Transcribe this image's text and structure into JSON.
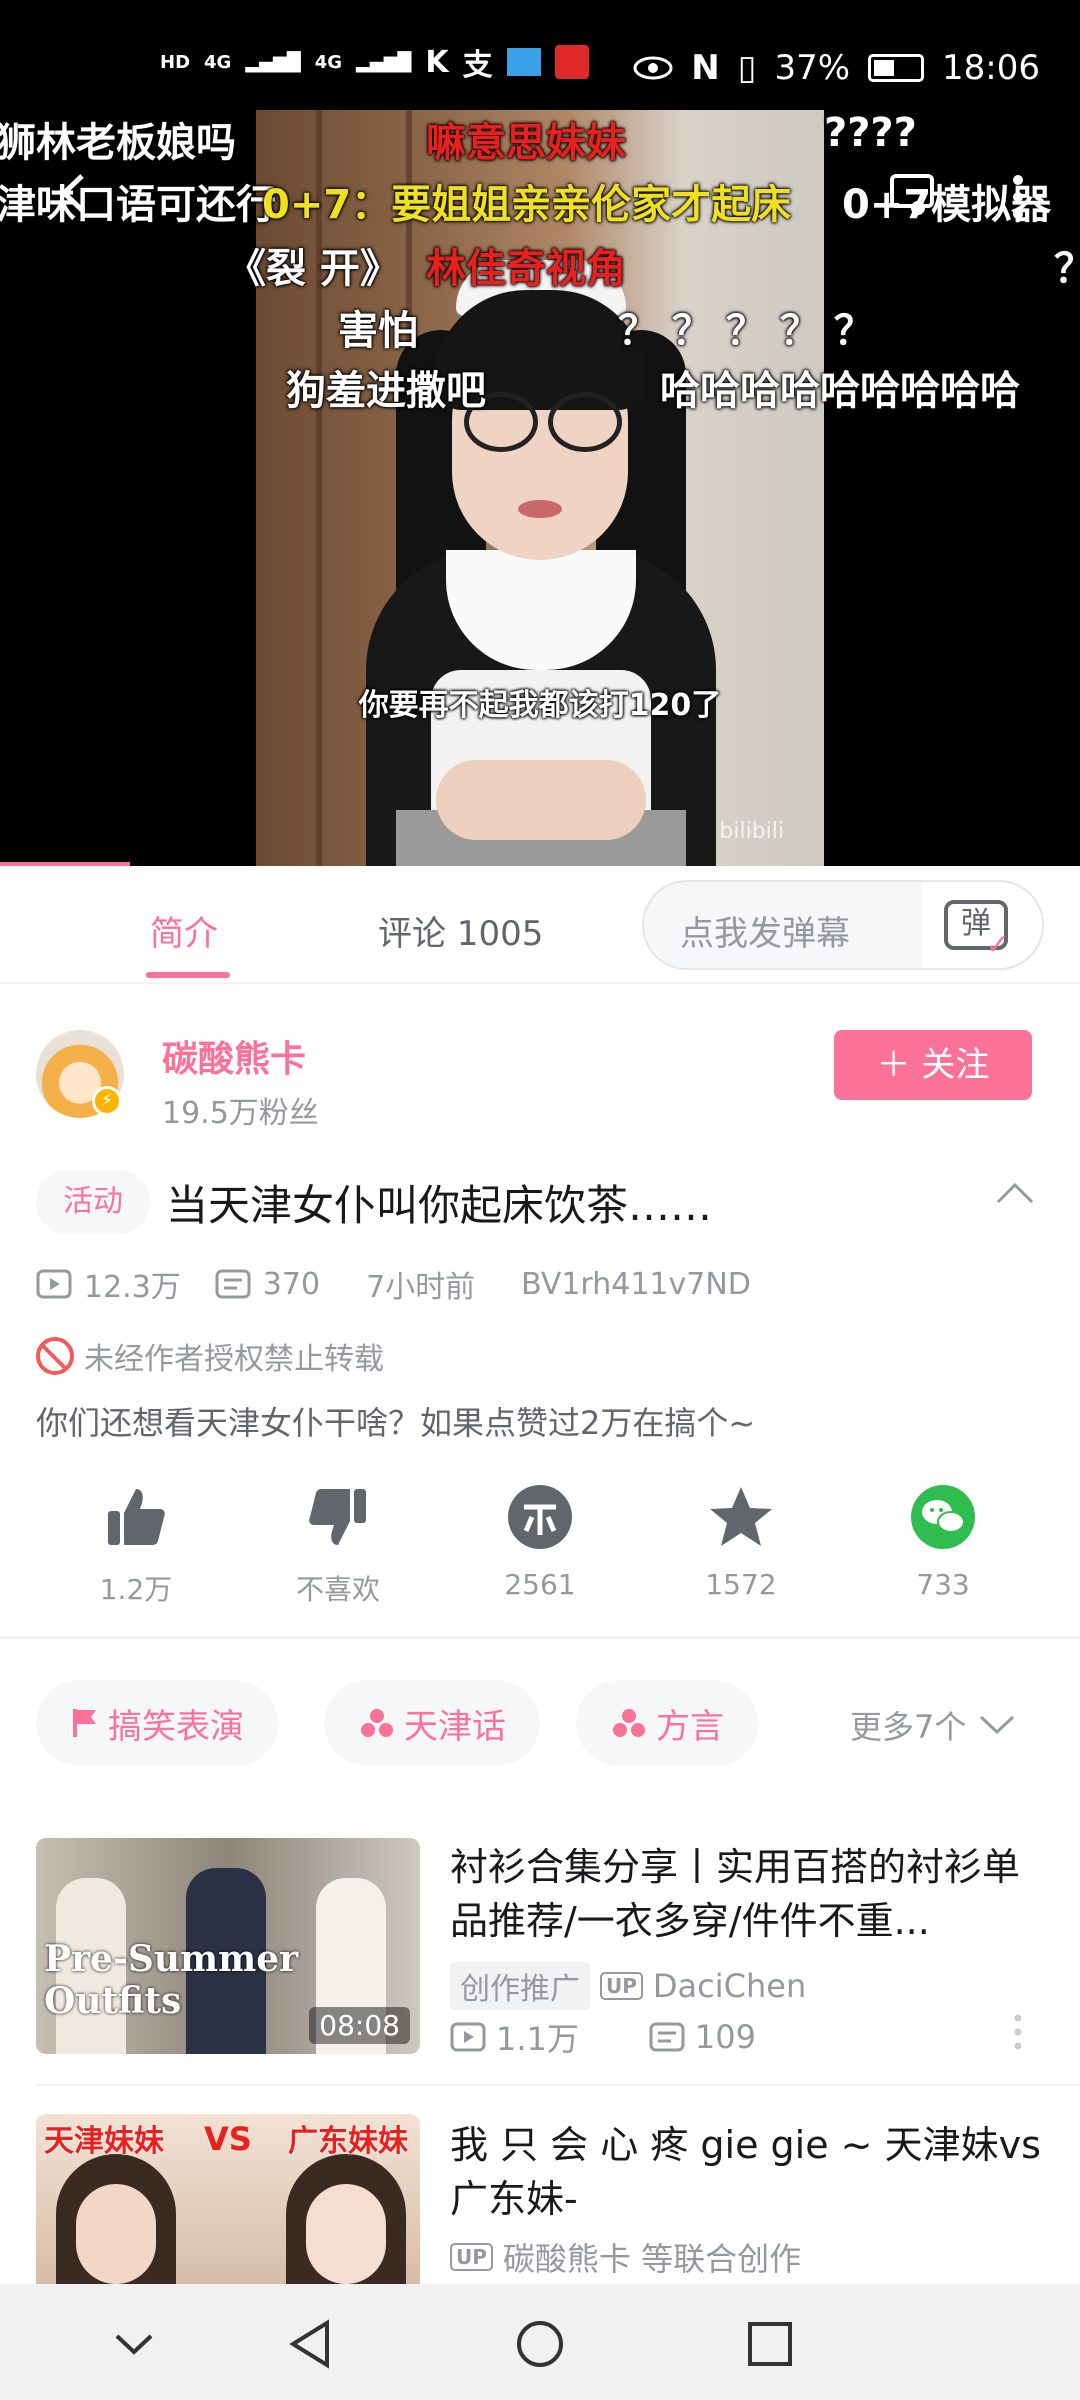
{
  "status_bar": {
    "network_labels": [
      "HD",
      "4G",
      "4G"
    ],
    "battery": "37%",
    "time": "18:06"
  },
  "video": {
    "subtitle": "你要再不起我都该打120了",
    "watermark": "bilibili",
    "danmaku": [
      {
        "text": "狮林老板娘吗",
        "color": "#ffffff"
      },
      {
        "text": "嘛意思妹妹",
        "color": "#e8211e"
      },
      {
        "text": "????",
        "color": "#ffffff"
      },
      {
        "text": "津味口语可还行",
        "color": "#ffffff"
      },
      {
        "text": "0+7：要姐姐亲亲伦家才起床",
        "color": "#f0e020"
      },
      {
        "text": "0+7模拟器",
        "color": "#ffffff"
      },
      {
        "text": "《裂 开》",
        "color": "#ffffff"
      },
      {
        "text": "林佳奇视角",
        "color": "#e8211e"
      },
      {
        "text": "？",
        "color": "#ffffff"
      },
      {
        "text": "害怕",
        "color": "#ffffff"
      },
      {
        "text": "？ ？ ？ ？ ？",
        "color": "#ffffff"
      },
      {
        "text": "狗羞进撒吧",
        "color": "#ffffff"
      },
      {
        "text": "哈哈哈哈哈哈哈哈哈",
        "color": "#ffffff"
      }
    ],
    "progress_fraction": 0.12
  },
  "tabs": {
    "intro": "简介",
    "comments": "评论 1005",
    "danmaku_placeholder": "点我发弹幕",
    "danmaku_toggle_glyph": "弹"
  },
  "uploader": {
    "name": "碳酸熊卡",
    "fans": "19.5万粉丝",
    "follow_label": "＋ 关注"
  },
  "video_info": {
    "activity_tag": "活动",
    "title": "当天津女仆叫你起床饮茶……",
    "views": "12.3万",
    "danmaku_count": "370",
    "time_ago": "7小时前",
    "bvid": "BV1rh411v7ND",
    "copyright": "未经作者授权禁止转载",
    "description": "你们还想看天津女仆干啥？如果点赞过2万在搞个~"
  },
  "actions": {
    "like": "1.2万",
    "dislike": "不喜欢",
    "coin": "2561",
    "favorite": "1572",
    "share": "733"
  },
  "tags": {
    "items": [
      "搞笑表演",
      "天津话",
      "方言"
    ],
    "more": "更多7个"
  },
  "related": [
    {
      "title": "衬衫合集分享丨实用百搭的衬衫单品推荐/一衣多穿/件件不重...",
      "thumb_text": "Pre-Summer Outfits",
      "duration": "08:08",
      "badge": "创作推广",
      "up_label": "UP",
      "author": "DaciChen",
      "views": "1.1万",
      "danmaku": "109"
    },
    {
      "title": "我 只 会 心 疼 gie gie ~ 天津妹vs广东妹-",
      "thumb_left": "天津妹妹",
      "thumb_vs": "VS",
      "thumb_right": "广东妹妹",
      "up_label": "UP",
      "author": "碳酸熊卡 等联合创作"
    }
  ],
  "colors": {
    "accent": "#fb7299",
    "muted": "#9499a0",
    "share_green": "#2ebd4e"
  }
}
